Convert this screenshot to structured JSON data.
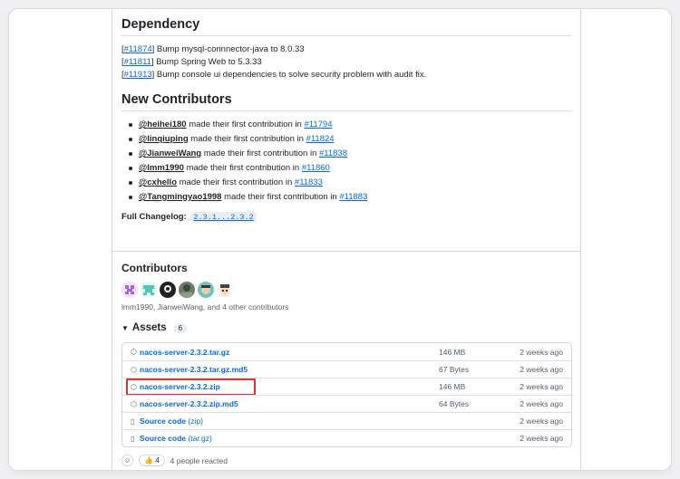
{
  "dependency": {
    "title": "Dependency",
    "items": [
      {
        "pr": "#11874",
        "text": " Bump mysql-connnector-java to 8.0.33"
      },
      {
        "pr": "#11811",
        "text": " Bump Spring Web to 5.3.33"
      },
      {
        "pr": "#11913",
        "text": " Bump console ui dependencies to solve security problem with audit fix."
      }
    ]
  },
  "new_contributors": {
    "title": "New Contributors",
    "made_text": " made their first contribution in ",
    "items": [
      {
        "user": "@heihei180",
        "pr": "#11794"
      },
      {
        "user": "@linqiuping",
        "pr": "#11824"
      },
      {
        "user": "@JianweiWang",
        "pr": "#11838"
      },
      {
        "user": "@lmm1990",
        "pr": "#11860"
      },
      {
        "user": "@cxhello",
        "pr": "#11833"
      },
      {
        "user": "@Tangmingyao1998",
        "pr": "#11883"
      }
    ],
    "changelog_label": "Full Changelog:",
    "changelog_range": "2.3.1...2.3.2"
  },
  "contributors": {
    "title": "Contributors",
    "summary": "lmm1990, JianweiWang, and 4 other contributors"
  },
  "assets": {
    "title": "Assets",
    "count": "6",
    "rows": [
      {
        "name": "nacos-server-2.3.2.tar.gz",
        "ext": "",
        "size": "146 MB",
        "date": "2 weeks ago",
        "icon": "package"
      },
      {
        "name": "nacos-server-2.3.2.tar.gz.md5",
        "ext": "",
        "size": "67 Bytes",
        "date": "2 weeks ago",
        "icon": "package"
      },
      {
        "name": "nacos-server-2.3.2.zip",
        "ext": "",
        "size": "146 MB",
        "date": "2 weeks ago",
        "icon": "package"
      },
      {
        "name": "nacos-server-2.3.2.zip.md5",
        "ext": "",
        "size": "64 Bytes",
        "date": "2 weeks ago",
        "icon": "package"
      },
      {
        "name": "Source code",
        "ext": " (zip)",
        "size": "",
        "date": "2 weeks ago",
        "icon": "file-zip"
      },
      {
        "name": "Source code",
        "ext": " (tar.gz)",
        "size": "",
        "date": "2 weeks ago",
        "icon": "file-zip"
      }
    ]
  },
  "reactions": {
    "emoji": "👍",
    "count": "4",
    "text": "4 people reacted"
  },
  "colors": {
    "link": "#0969da",
    "highlight": "#e03131"
  }
}
